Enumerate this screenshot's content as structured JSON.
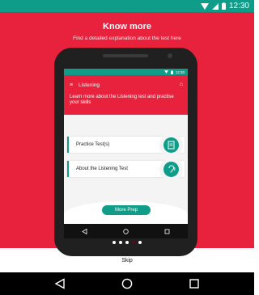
{
  "status_bar": {
    "time": "12:30"
  },
  "hero": {
    "title": "Know more",
    "subtitle": "Find a detailed explanation about the test here"
  },
  "inner_app": {
    "status_time": "12:30",
    "header_title": "Listening",
    "header_description": "Learn more about the Listening test and practise your skills",
    "cards": [
      {
        "label": "Practice Test(s)",
        "icon": "document-icon"
      },
      {
        "label": "About the Listening Test",
        "icon": "ear-icon"
      }
    ],
    "more_button": "More Prep"
  },
  "pager": {
    "total": 5,
    "active_index": 3
  },
  "skip_label": "Skip",
  "colors": {
    "accent_red": "#e8213c",
    "teal": "#0f9d8a",
    "nav_black": "#000000"
  }
}
